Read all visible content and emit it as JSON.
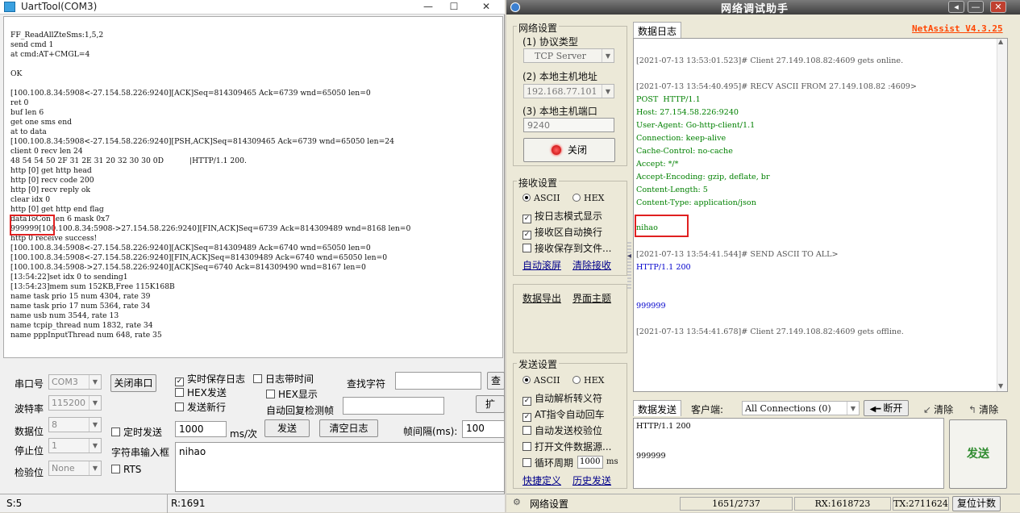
{
  "uart": {
    "title": "UartTool(COM3)",
    "window_buttons": [
      "—",
      "☐",
      "✕"
    ],
    "log": [
      "FF_ReadAllZteSms:1,5,2",
      "send cmd 1",
      "at cmd:AT+CMGL=4",
      "",
      "OK",
      "",
      "[100.100.8.34:5908<-27.154.58.226:9240][ACK]Seq=814309465 Ack=6739 wnd=65050 len=0",
      "ret 0",
      "buf len 6",
      "get one sms end",
      "at to data",
      "[100.100.8.34:5908<-27.154.58.226:9240][PSH,ACK]Seq=814309465 Ack=6739 wnd=65050 len=24",
      "client 0 recv len 24",
      "48 54 54 50 2F 31 2E 31 20 32 30 30 0D           |HTTP/1.1 200.",
      "http [0] get http head",
      "http [0] recv code 200",
      "http [0] recv reply ok",
      "clear idx 0",
      "http [0] get http end flag",
      "dataToCon len 6 mask 0x7",
      "999999[100.100.8.34:5908->27.154.58.226:9240][FIN,ACK]Seq=6739 Ack=814309489 wnd=8168 len=0",
      "http 0 receive success!",
      "[100.100.8.34:5908<-27.154.58.226:9240][ACK]Seq=814309489 Ack=6740 wnd=65050 len=0",
      "[100.100.8.34:5908<-27.154.58.226:9240][FIN,ACK]Seq=814309489 Ack=6740 wnd=65050 len=0",
      "[100.100.8.34:5908->27.154.58.226:9240][ACK]Seq=6740 Ack=814309490 wnd=8167 len=0",
      "[13:54:22]set idx 0 to sending1",
      "[13:54:23]mem sum 152KB,Free 115K168B",
      "name task prio 15 num 4304, rate 39",
      "name task prio 17 num 5364, rate 34",
      "name usb num 3544, rate 13",
      "name tcpip_thread num 1832, rate 34",
      "name pppInputThread num 648, rate 35"
    ],
    "labels": {
      "port": "串口号",
      "baud": "波特率",
      "data_bits": "数据位",
      "stop_bits": "停止位",
      "parity": "检验位",
      "close_port": "关闭串口",
      "realtime_save": "实时保存日志",
      "log_time": "日志带时间",
      "hex_send": "HEX发送",
      "hex_display": "HEX显示",
      "send_newline": "发送新行",
      "auto_reply": "自动回复检测帧",
      "find_string": "查找字符",
      "find_btn": "查",
      "expand_btn": "扩",
      "timed_send": "定时发送",
      "ms_unit": "ms/次",
      "send_btn": "发送",
      "clear_log": "清空日志",
      "frame_interval": "帧间隔(ms):",
      "input_box_label": "字符串输入框",
      "rts": "RTS"
    },
    "values": {
      "port": "COM3",
      "baud": "115200",
      "data_bits": "8",
      "stop_bits": "1",
      "parity": "None",
      "timer_ms": "1000",
      "frame_interval": "100",
      "input_text": "nihao",
      "realtime_save_checked": true
    },
    "status": {
      "s": "S:5",
      "r": "R:1691"
    }
  },
  "net": {
    "title": "网络调试助手",
    "version": "NetAssist V4.3.25",
    "window_buttons": [
      "◂",
      "—",
      "✕"
    ],
    "network_settings": {
      "title": "网络设置",
      "protocol_label": "(1) 协议类型",
      "protocol_value": "TCP Server",
      "host_label": "(2) 本地主机地址",
      "host_value": "192.168.77.101",
      "port_label": "(3) 本地主机端口",
      "port_value": "9240",
      "close_btn": "关闭"
    },
    "receive_settings": {
      "title": "接收设置",
      "ascii": "ASCII",
      "hex": "HEX",
      "opt1": "按日志模式显示",
      "opt2": "接收区自动换行",
      "opt3": "接收保存到文件...",
      "auto_scroll": "自动滚屏",
      "clear_recv": "清除接收"
    },
    "export": {
      "data_export": "数据导出",
      "ui_theme": "界面主题"
    },
    "send_settings": {
      "title": "发送设置",
      "ascii": "ASCII",
      "hex": "HEX",
      "opt1": "自动解析转义符",
      "opt2": "AT指令自动回车",
      "opt3": "自动发送校验位",
      "opt4": "打开文件数据源...",
      "opt5": "循环周期",
      "cycle_ms": "1000",
      "ms": "ms",
      "shortcut": "快捷定义",
      "history": "历史发送"
    },
    "log_tab": "数据日志",
    "log": [
      {
        "text": "[2021-07-13 13:53:01.523]# Client 27.149.108.82:4609 gets online.",
        "color": "#555555"
      },
      {
        "text": "[2021-07-13 13:54:40.495]# RECV ASCII FROM 27.149.108.82 :4609>",
        "color": "#555555"
      },
      {
        "text": "POST  HTTP/1.1",
        "color": "#008000"
      },
      {
        "text": "Host: 27.154.58.226:9240",
        "color": "#008000"
      },
      {
        "text": "User-Agent: Go-http-client/1.1",
        "color": "#008000"
      },
      {
        "text": "Connection: keep-alive",
        "color": "#008000"
      },
      {
        "text": "Cache-Control: no-cache",
        "color": "#008000"
      },
      {
        "text": "Accept: */*",
        "color": "#008000"
      },
      {
        "text": "Accept-Encoding: gzip, deflate, br",
        "color": "#008000"
      },
      {
        "text": "Content-Length: 5",
        "color": "#008000"
      },
      {
        "text": "Content-Type: application/json",
        "color": "#008000"
      },
      {
        "text": "nihao",
        "color": "#008000"
      },
      {
        "text": "[2021-07-13 13:54:41.544]# SEND ASCII TO ALL>",
        "color": "#555555"
      },
      {
        "text": "HTTP/1.1 200",
        "color": "#0000cc"
      },
      {
        "text": "999999",
        "color": "#0000cc"
      },
      {
        "text": "[2021-07-13 13:54:41.678]# Client 27.149.108.82:4609 gets offline.",
        "color": "#555555"
      }
    ],
    "send_tab": "数据发送",
    "client_label": "客户端:",
    "client_value": "All Connections (0)",
    "disconnect_btn": "断开",
    "clear1": "清除",
    "clear2": "清除",
    "send_text_line1": "HTTP/1.1 200",
    "send_text_line2": "999999",
    "send_btn": "发送",
    "status": {
      "network_settings": "网络设置",
      "count": "1651/2737",
      "rx": "RX:1618723",
      "tx": "TX:2711624",
      "reset": "复位计数"
    }
  }
}
